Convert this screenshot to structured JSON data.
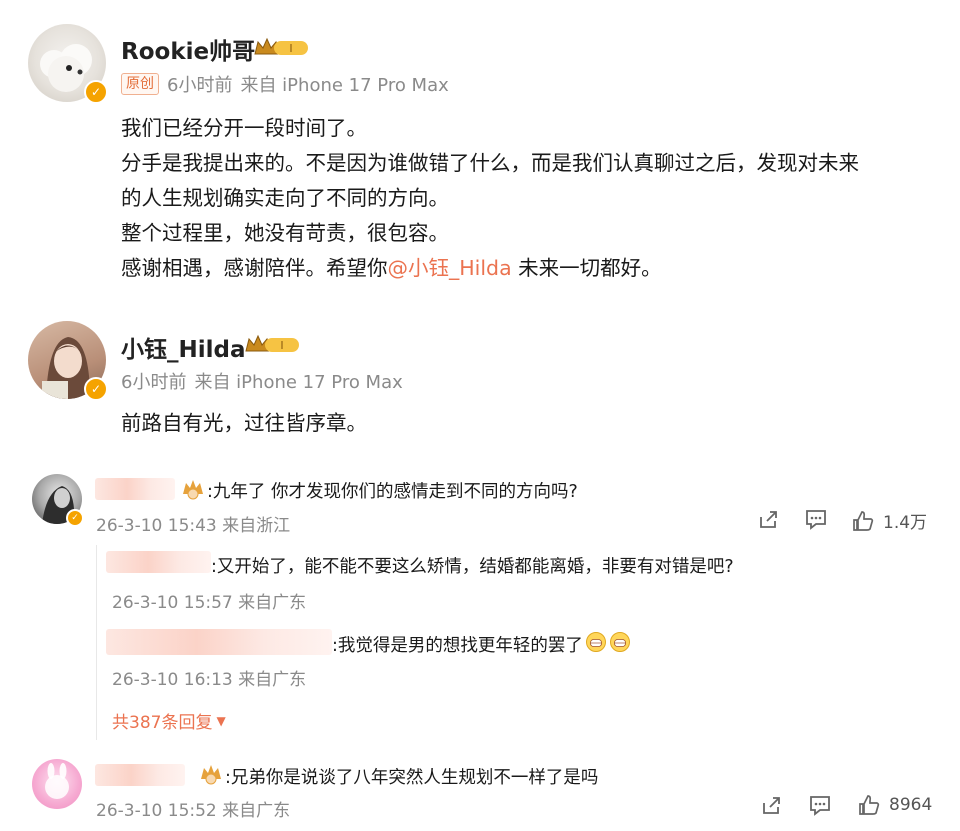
{
  "post1": {
    "name": "Rookie帅哥",
    "tag": "原创",
    "time": "6小时前",
    "from": "来自 iPhone 17 Pro Max",
    "lines": [
      "我们已经分开一段时间了。",
      "分手是我提出来的。不是因为谁做错了什么，而是我们认真聊过之后，发现对未来",
      "的人生规划确实走向了不同的方向。",
      "整个过程里，她没有苛责，很包容。"
    ],
    "last_line_before": "感谢相遇，感谢陪伴。希望你",
    "mention": "@小钰_Hilda",
    "last_line_after": " 未来一切都好。"
  },
  "post2": {
    "name": "小钰_Hilda",
    "time": "6小时前",
    "from": "来自 iPhone 17 Pro Max",
    "text": "前路自有光，过往皆序章。"
  },
  "comment1": {
    "text": ":九年了 你才发现你们的感情走到不同的方向吗?",
    "time": "26-3-10 15:43 来自浙江",
    "likes": "1.4万"
  },
  "replies": [
    {
      "text": ":又开始了，能不能不要这么矫情，结婚都能离婚，非要有对错是吧?",
      "time": "26-3-10 15:57 来自广东"
    },
    {
      "text": ":我觉得是男的想找更年轻的罢了",
      "time": "26-3-10 16:13 来自广东"
    }
  ],
  "more_replies": "共387条回复",
  "comment2": {
    "text": ":兄弟你是说谈了八年突然人生规划不一样了是吗",
    "time": "26-3-10 15:52 来自广东",
    "likes": "8964"
  },
  "colors": {
    "accent": "#eb7350",
    "meta": "#8a8a8a",
    "verified": "#f5a300"
  }
}
